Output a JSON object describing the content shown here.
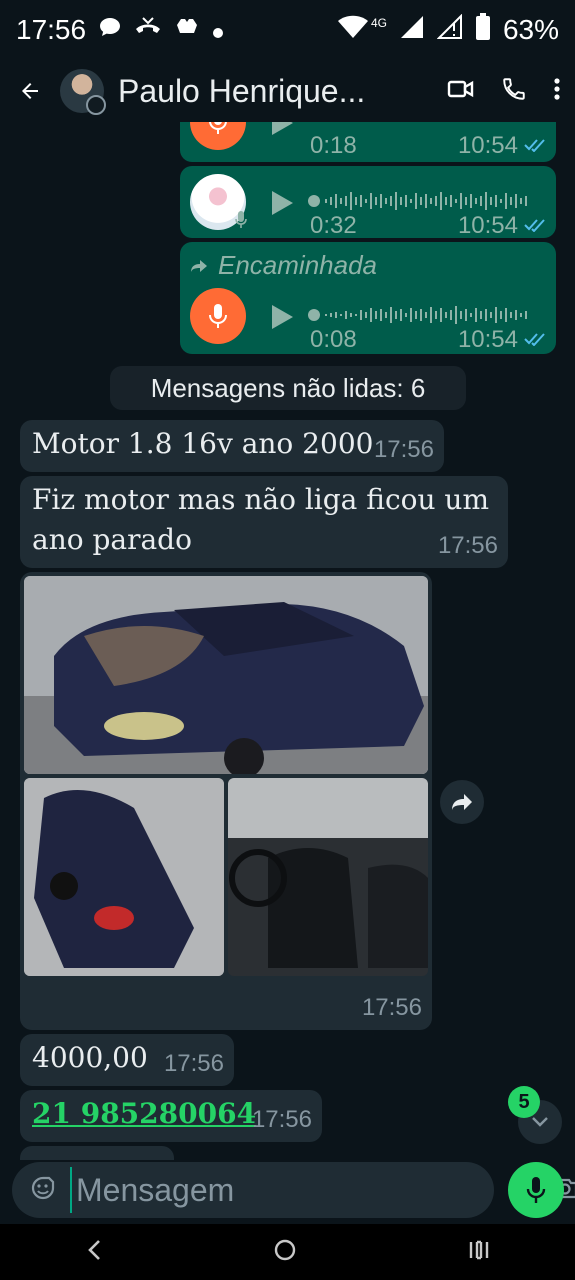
{
  "status_bar": {
    "time": "17:56",
    "network": "4G",
    "battery": "63%"
  },
  "header": {
    "contact_name": "Paulo Henrique..."
  },
  "messages": {
    "voice_1": {
      "duration": "0:18",
      "time": "10:54"
    },
    "voice_2": {
      "duration": "0:32",
      "time": "10:54"
    },
    "voice_3": {
      "forwarded_label": "Encaminhada",
      "duration": "0:08",
      "time": "10:54"
    },
    "unread_separator": "Mensagens não lidas: 6",
    "text_1": {
      "text": "Motor 1.8 16v ano 2000",
      "time": "17:56"
    },
    "text_2": {
      "text_line1": "Fiz motor mas não liga ficou um",
      "text_line2": "ano parado",
      "time": "17:56"
    },
    "album": {
      "time": "17:56"
    },
    "text_3": {
      "text": "4000,00",
      "time": "17:56"
    },
    "text_4": {
      "phone": "21 985280064",
      "time": "17:56"
    }
  },
  "scroll_badge": "5",
  "composer": {
    "placeholder": "Mensagem"
  },
  "colors": {
    "background": "#0b141a",
    "outgoing_bubble": "#005c4b",
    "incoming_bubble": "#1f2c34",
    "accent_green": "#25d366",
    "voice_mic_orange": "#ff6b35"
  }
}
